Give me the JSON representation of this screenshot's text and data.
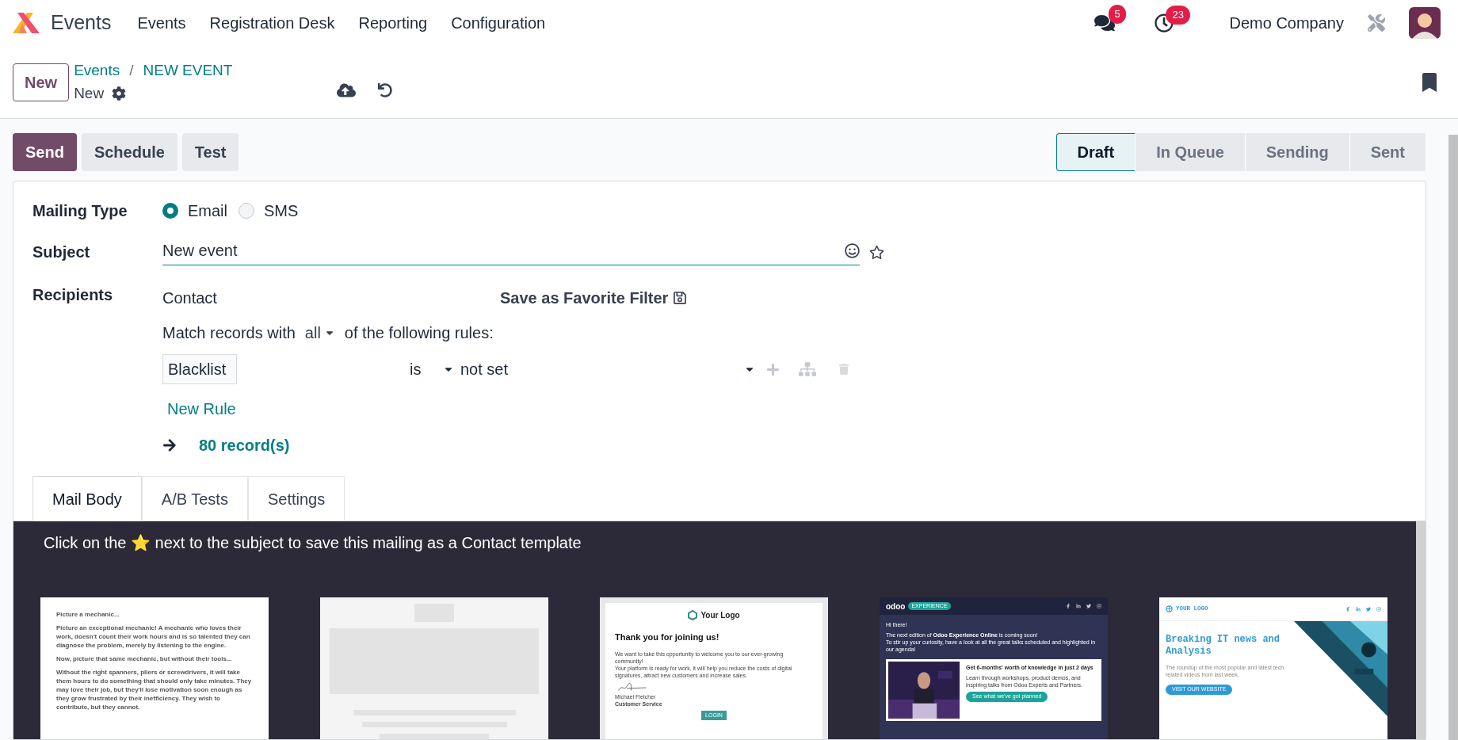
{
  "navbar": {
    "app_name": "Events",
    "menu": [
      "Events",
      "Registration Desk",
      "Reporting",
      "Configuration"
    ],
    "messages_badge": "5",
    "activities_badge": "23",
    "company": "Demo Company"
  },
  "control_panel": {
    "new_button": "New",
    "breadcrumb": [
      "Events",
      "NEW EVENT"
    ],
    "breadcrumb_separator": "/",
    "record_name": "New"
  },
  "actions": [
    {
      "label": "Send",
      "kind": "primary"
    },
    {
      "label": "Schedule",
      "kind": "secondary"
    },
    {
      "label": "Test",
      "kind": "secondary"
    }
  ],
  "statusbar": [
    {
      "label": "Draft",
      "selected": true
    },
    {
      "label": "In Queue",
      "selected": false
    },
    {
      "label": "Sending",
      "selected": false
    },
    {
      "label": "Sent",
      "selected": false
    }
  ],
  "form": {
    "mailing_type": {
      "label": "Mailing Type",
      "options": [
        {
          "label": "Email",
          "selected": true
        },
        {
          "label": "SMS",
          "selected": false
        }
      ]
    },
    "subject": {
      "label": "Subject",
      "value": "New event"
    },
    "recipients": {
      "label": "Recipients",
      "model": "Contact",
      "save_filter": "Save as Favorite Filter",
      "match_prefix": "Match records with",
      "match_value": "all",
      "match_suffix": "of the following rules:",
      "rule": {
        "field": "Blacklist",
        "operator": "is",
        "value": "not set"
      },
      "new_rule": "New Rule",
      "records": "80 record(s)"
    }
  },
  "tabs": [
    {
      "label": "Mail Body",
      "selected": true
    },
    {
      "label": "A/B Tests",
      "selected": false
    },
    {
      "label": "Settings",
      "selected": false
    }
  ],
  "mail_body": {
    "banner": "Click on the ⭐ next to the subject to save this mailing as a Contact template",
    "templates": [
      {
        "kind": "text",
        "paragraphs": [
          "Picture a mechanic...",
          "Picture an exceptional mechanic! A mechanic who loves their work, doesn't count their work hours and is so talented they can diagnose the problem, merely by listening to the engine.",
          "Now, picture that same mechanic, but without their tools...",
          "Without the right spanners, pliers or screwdrivers, it will take them hours to do something that should only take minutes. They may love their job, but they'll lose motivation soon enough as they grow frustrated by their inefficiency. They wish to contribute, but they cannot."
        ]
      },
      {
        "kind": "blank"
      },
      {
        "kind": "welcome",
        "logo": "Your Logo",
        "title": "Thank you for joining us!",
        "paragraphs": [
          "We want to take this opportunity to welcome you to our ever-growing community!",
          "Your platform is ready for work, it will help you reduce the costs of digital signatures, attract new customers and increase sales."
        ],
        "signer": "Michael Fletcher",
        "role": "Customer Service",
        "button": "LOGIN"
      },
      {
        "kind": "newsletter",
        "logo": "odoo",
        "tag": "EXPERIENCE",
        "greeting": "Hi there!",
        "intro": "The next edition of **Odoo Experience Online** is coming soon!",
        "intro_2": "To stir up your curiosity, have a look at all the great talks scheduled and highlighted in our agenda!",
        "card_title": "Get 6-months' worth of knowledge in just 2 days",
        "card_text": "Learn through workshops, product demos, and inspiring talks from Odoo Experts and Partners.",
        "button": "See what we've got planned"
      },
      {
        "kind": "news",
        "logo": "YOUR LOGO",
        "title": "Breaking IT news and Analysis",
        "text": "The roundup of the most popular and latest tech related videos from last week.",
        "button": "VISIT OUR WEBSITE"
      }
    ]
  }
}
